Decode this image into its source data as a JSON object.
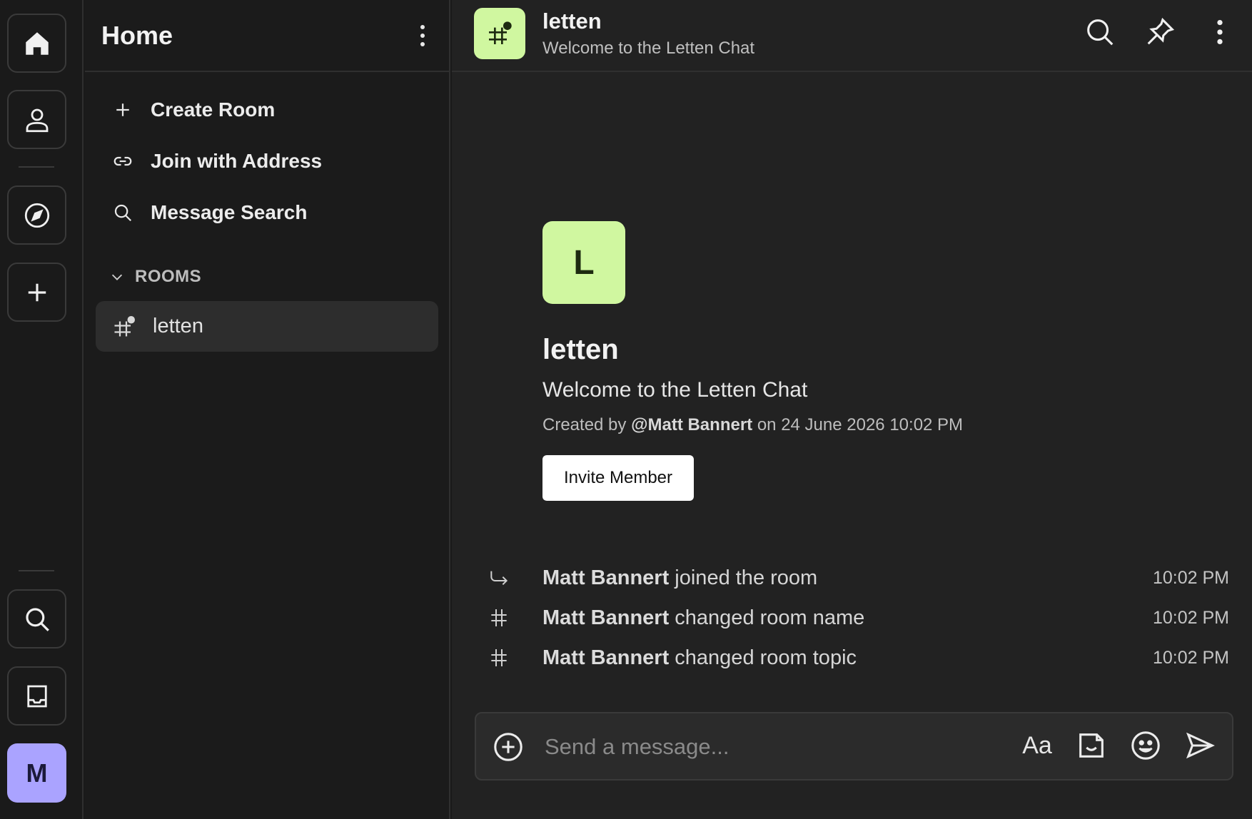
{
  "rail": {
    "avatar_letter": "M",
    "avatar_color": "#aaa3ff"
  },
  "sidebar": {
    "title": "Home",
    "actions": [
      {
        "label": "Create Room",
        "icon": "plus-icon"
      },
      {
        "label": "Join with Address",
        "icon": "link-icon"
      },
      {
        "label": "Message Search",
        "icon": "search-icon"
      }
    ],
    "rooms_label": "ROOMS",
    "rooms": [
      {
        "name": "letten",
        "icon": "hash-public-icon",
        "selected": true
      }
    ]
  },
  "header": {
    "room_name": "letten",
    "topic": "Welcome to the Letten Chat",
    "avatar_color": "#d0f7a0"
  },
  "intro": {
    "avatar_letter": "L",
    "room_name": "letten",
    "topic": "Welcome to the Letten Chat",
    "created_prefix": "Created by",
    "creator": "@Matt Bannert",
    "created_suffix": "on 24 June 2026 10:02 PM",
    "invite_label": "Invite Member"
  },
  "events": [
    {
      "icon": "join-arrow-icon",
      "user": "Matt Bannert",
      "text": "joined the room",
      "time": "10:02 PM"
    },
    {
      "icon": "hash-icon",
      "user": "Matt Bannert",
      "text": "changed room name",
      "time": "10:02 PM"
    },
    {
      "icon": "hash-icon",
      "user": "Matt Bannert",
      "text": "changed room topic",
      "time": "10:02 PM"
    }
  ],
  "composer": {
    "placeholder": "Send a message...",
    "format_label": "Aa"
  }
}
